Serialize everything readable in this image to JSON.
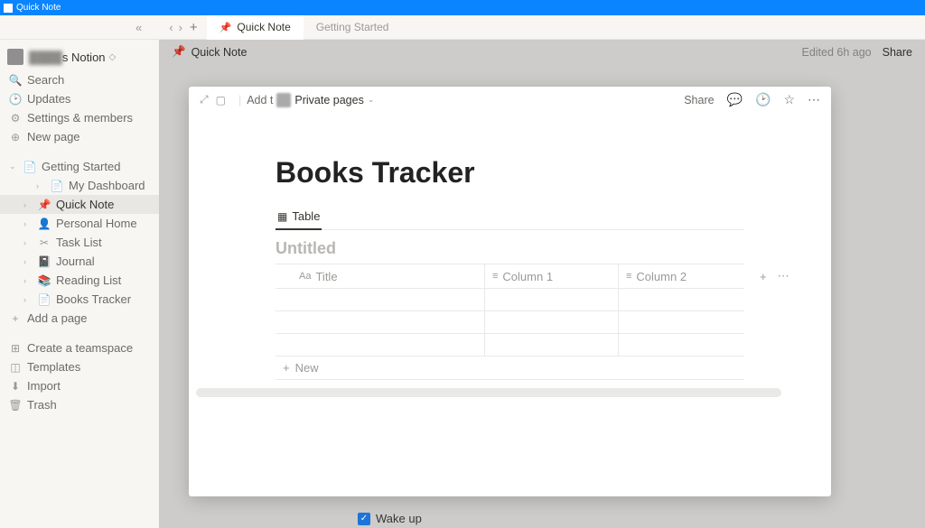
{
  "titlebar": {
    "title": "Quick Note"
  },
  "tabbar": {
    "active_tab": "Quick Note",
    "inactive_tab": "Getting Started"
  },
  "sidebar": {
    "workspace_name_visible": "s Notion",
    "search": "Search",
    "updates": "Updates",
    "settings": "Settings & members",
    "new_page": "New page",
    "tree": {
      "getting_started": "Getting Started",
      "my_dashboard": "My Dashboard",
      "quick_note": "Quick Note",
      "personal_home": "Personal Home",
      "task_list": "Task List",
      "journal": "Journal",
      "reading_list": "Reading List",
      "books_tracker": "Books Tracker",
      "add_a_page": "Add a page"
    },
    "footer": {
      "create_teamspace": "Create a teamspace",
      "templates": "Templates",
      "import": "Import",
      "trash": "Trash"
    }
  },
  "topbar": {
    "breadcrumb": "Quick Note",
    "edited": "Edited 6h ago",
    "share": "Share"
  },
  "modal": {
    "addto_prefix": "Add t",
    "private_pages": "Private pages",
    "share": "Share",
    "page_title": "Books Tracker",
    "view_tab": "Table",
    "db_title": "Untitled",
    "columns": {
      "title": "Title",
      "col1": "Column 1",
      "col2": "Column 2"
    },
    "new": "New"
  },
  "wakeup": {
    "label": "Wake up"
  }
}
